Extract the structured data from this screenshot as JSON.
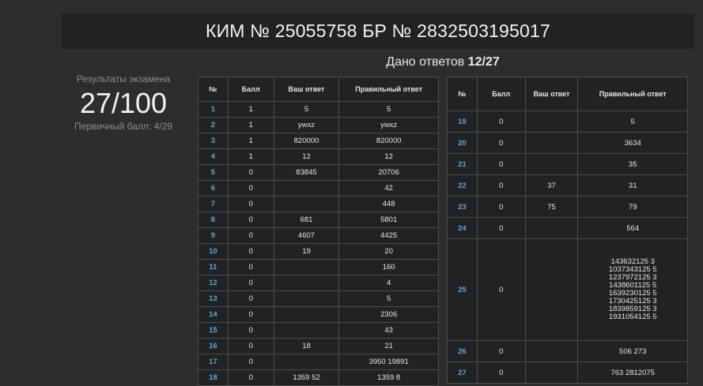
{
  "header": {
    "title": "КИМ № 25055758 БР № 2832503195017"
  },
  "given": {
    "label": "Дано ответов",
    "value": "12/27"
  },
  "results": {
    "label": "Результаты экзамена",
    "score": "27/100",
    "primary": "Первичный балл: 4/29"
  },
  "table_headers": {
    "num": "№",
    "score": "Балл",
    "your": "Ваш ответ",
    "correct": "Правильный ответ"
  },
  "rows_left": [
    {
      "num": "1",
      "score": "1",
      "your": "5",
      "correct": "5"
    },
    {
      "num": "2",
      "score": "1",
      "your": "ywxz",
      "correct": "ywxz"
    },
    {
      "num": "3",
      "score": "1",
      "your": "820000",
      "correct": "820000"
    },
    {
      "num": "4",
      "score": "1",
      "your": "12",
      "correct": "12"
    },
    {
      "num": "5",
      "score": "0",
      "your": "83845",
      "correct": "20706"
    },
    {
      "num": "6",
      "score": "0",
      "your": "",
      "correct": "42"
    },
    {
      "num": "7",
      "score": "0",
      "your": "",
      "correct": "448"
    },
    {
      "num": "8",
      "score": "0",
      "your": "681",
      "correct": "5801"
    },
    {
      "num": "9",
      "score": "0",
      "your": "4607",
      "correct": "4425"
    },
    {
      "num": "10",
      "score": "0",
      "your": "19",
      "correct": "20"
    },
    {
      "num": "11",
      "score": "0",
      "your": "",
      "correct": "160"
    },
    {
      "num": "12",
      "score": "0",
      "your": "",
      "correct": "4"
    },
    {
      "num": "13",
      "score": "0",
      "your": "",
      "correct": "5"
    },
    {
      "num": "14",
      "score": "0",
      "your": "",
      "correct": "2306"
    },
    {
      "num": "15",
      "score": "0",
      "your": "",
      "correct": "43"
    },
    {
      "num": "16",
      "score": "0",
      "your": "18",
      "correct": "21"
    },
    {
      "num": "17",
      "score": "0",
      "your": "",
      "correct": "3950 19891"
    },
    {
      "num": "18",
      "score": "0",
      "your": "1359 52",
      "correct": "1359 8"
    }
  ],
  "rows_right": [
    {
      "num": "19",
      "score": "0",
      "your": "",
      "correct": "5"
    },
    {
      "num": "20",
      "score": "0",
      "your": "",
      "correct": "3634"
    },
    {
      "num": "21",
      "score": "0",
      "your": "",
      "correct": "35"
    },
    {
      "num": "22",
      "score": "0",
      "your": "37",
      "correct": "31"
    },
    {
      "num": "23",
      "score": "0",
      "your": "75",
      "correct": "79"
    },
    {
      "num": "24",
      "score": "0",
      "your": "",
      "correct": "564"
    },
    {
      "num": "25",
      "score": "0",
      "your": "",
      "correct_lines": [
        "143632125 3",
        "1037343125 5",
        "1237972125 3",
        "1438601125 5",
        "1639230125 5",
        "1730425125 3",
        "1839859125 3",
        "1931054125 5"
      ]
    },
    {
      "num": "26",
      "score": "0",
      "your": "",
      "correct": "506 273"
    },
    {
      "num": "27",
      "score": "0",
      "your": "",
      "correct": "763 2812075"
    }
  ]
}
